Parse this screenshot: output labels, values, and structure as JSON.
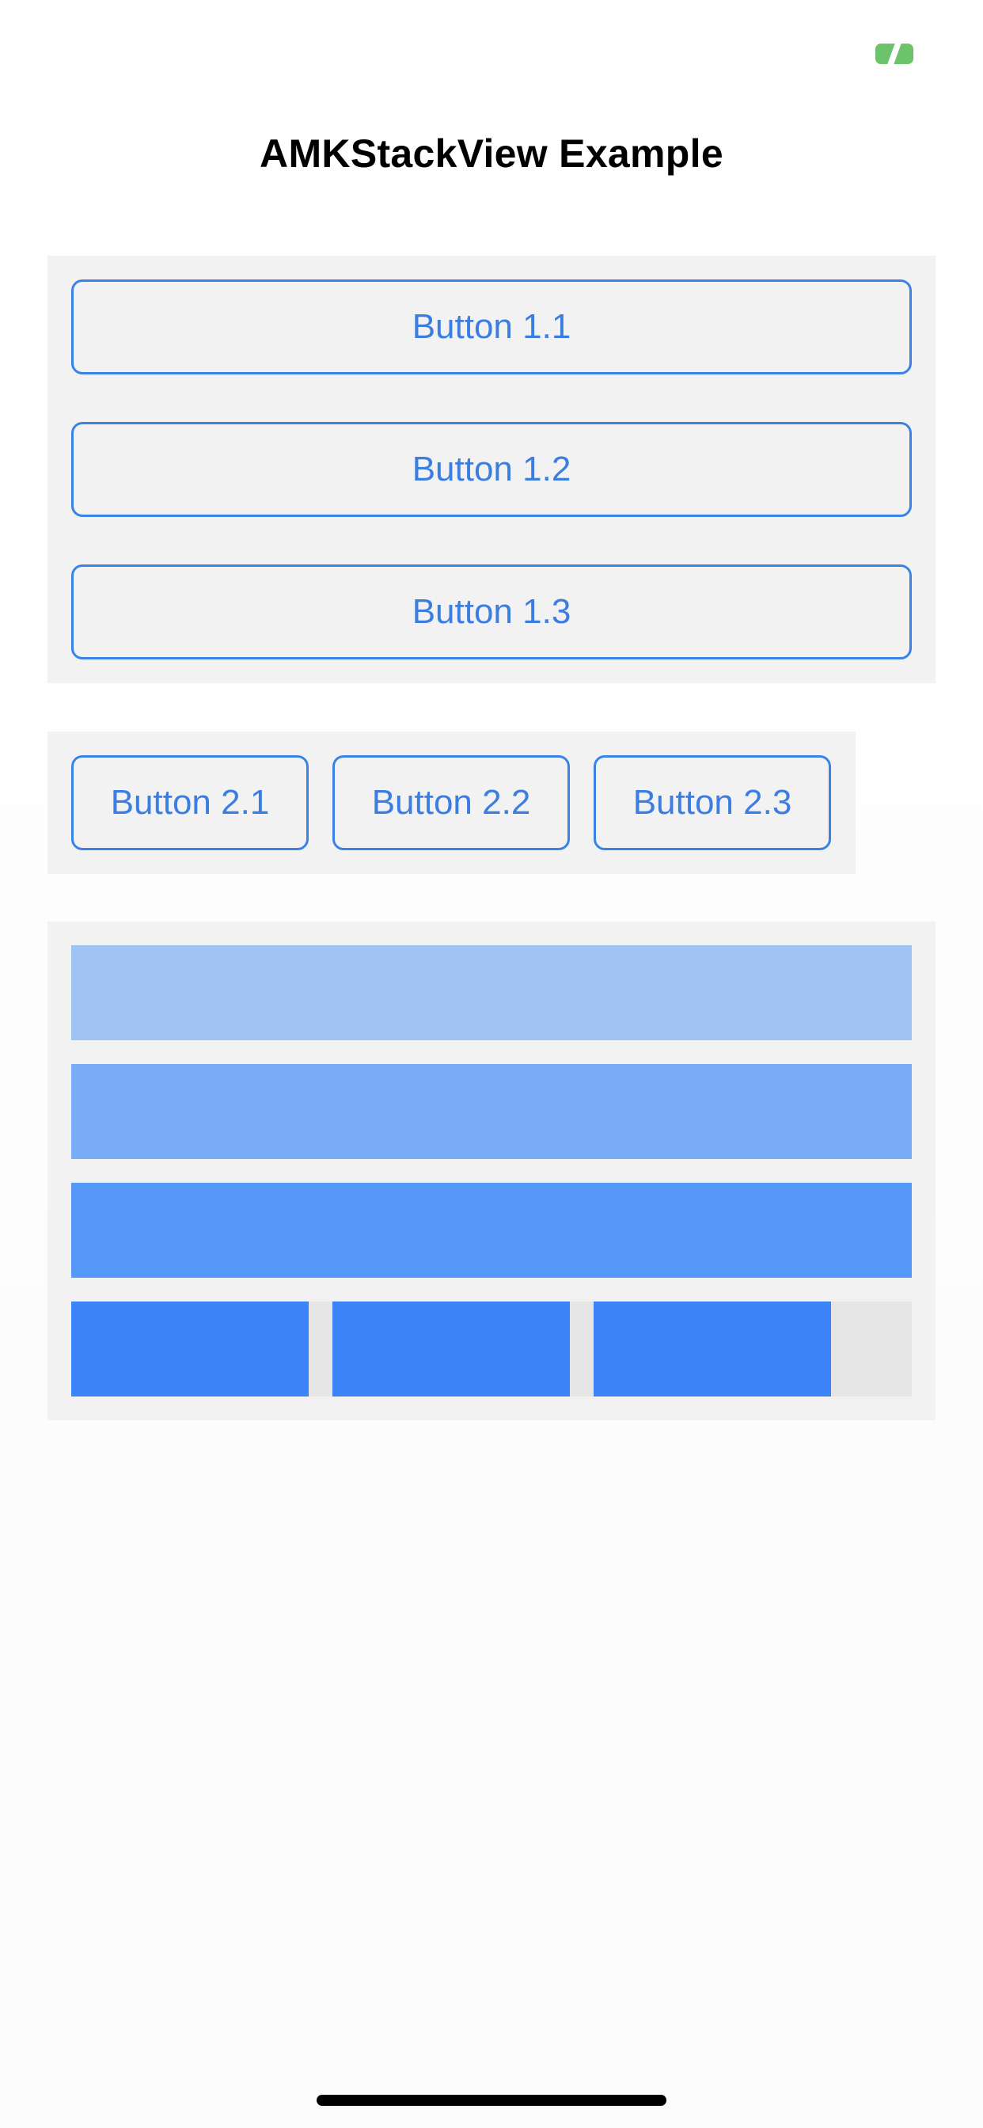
{
  "status_bar": {
    "battery_icon": "battery-charging-icon",
    "battery_color": "#6cc36b"
  },
  "title": "AMKStackView Example",
  "stack1": {
    "background": "#f2f2f3",
    "buttons": [
      {
        "label": "Button 1.1"
      },
      {
        "label": "Button 1.2"
      },
      {
        "label": "Button 1.3"
      }
    ]
  },
  "stack2": {
    "background": "#f2f2f3",
    "buttons": [
      {
        "label": "Button 2.1"
      },
      {
        "label": "Button 2.2"
      },
      {
        "label": "Button 2.3"
      }
    ]
  },
  "stack3": {
    "background": "#f2f2f3",
    "bars": [
      {
        "color": "#a0c3f3"
      },
      {
        "color": "#78acf5"
      },
      {
        "color": "#5598f7"
      }
    ],
    "row_background": "#e6e6e7",
    "squares": [
      {
        "color": "#3b83f6"
      },
      {
        "color": "#3b83f6"
      },
      {
        "color": "#3b83f6"
      }
    ]
  },
  "colors": {
    "accent": "#3b82e6",
    "button_text": "#3b7de0"
  }
}
